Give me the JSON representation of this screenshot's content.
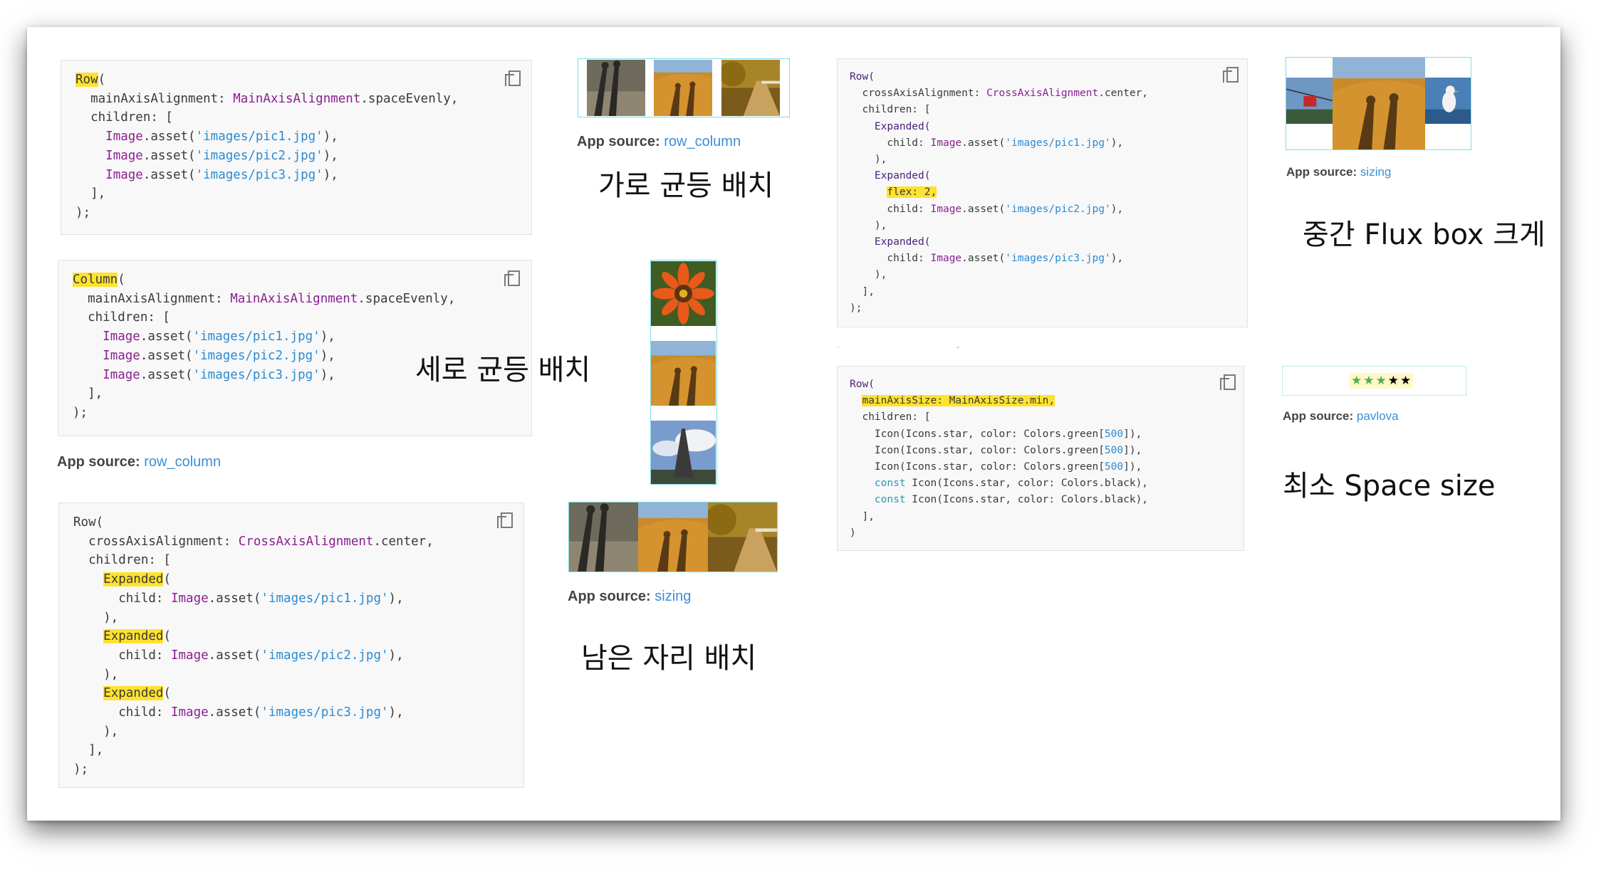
{
  "blocks": {
    "row_even": {
      "lines": [
        [
          {
            "t": "Row",
            "c": "hl"
          },
          {
            "t": "("
          }
        ],
        [
          {
            "t": "  mainAxisAlignment: "
          },
          {
            "t": "MainAxisAlignment",
            "c": "cls"
          },
          {
            "t": ".spaceEvenly,"
          }
        ],
        [
          {
            "t": "  children: ["
          }
        ],
        [
          {
            "t": "    "
          },
          {
            "t": "Image",
            "c": "cls"
          },
          {
            "t": ".asset("
          },
          {
            "t": "'images/pic1.jpg'",
            "c": "str"
          },
          {
            "t": "),"
          }
        ],
        [
          {
            "t": "    "
          },
          {
            "t": "Image",
            "c": "cls"
          },
          {
            "t": ".asset("
          },
          {
            "t": "'images/pic2.jpg'",
            "c": "str"
          },
          {
            "t": "),"
          }
        ],
        [
          {
            "t": "    "
          },
          {
            "t": "Image",
            "c": "cls"
          },
          {
            "t": ".asset("
          },
          {
            "t": "'images/pic3.jpg'",
            "c": "str"
          },
          {
            "t": "),"
          }
        ],
        [
          {
            "t": "  ],"
          }
        ],
        [
          {
            "t": ");"
          }
        ]
      ]
    },
    "column_even": {
      "lines": [
        [
          {
            "t": "Column",
            "c": "hl"
          },
          {
            "t": "("
          }
        ],
        [
          {
            "t": "  mainAxisAlignment: "
          },
          {
            "t": "MainAxisAlignment",
            "c": "cls"
          },
          {
            "t": ".spaceEvenly,"
          }
        ],
        [
          {
            "t": "  children: ["
          }
        ],
        [
          {
            "t": "    "
          },
          {
            "t": "Image",
            "c": "cls"
          },
          {
            "t": ".asset("
          },
          {
            "t": "'images/pic1.jpg'",
            "c": "str"
          },
          {
            "t": "),"
          }
        ],
        [
          {
            "t": "    "
          },
          {
            "t": "Image",
            "c": "cls"
          },
          {
            "t": ".asset("
          },
          {
            "t": "'images/pic2.jpg'",
            "c": "str"
          },
          {
            "t": "),"
          }
        ],
        [
          {
            "t": "    "
          },
          {
            "t": "Image",
            "c": "cls"
          },
          {
            "t": ".asset("
          },
          {
            "t": "'images/pic3.jpg'",
            "c": "str"
          },
          {
            "t": "),"
          }
        ],
        [
          {
            "t": "  ],"
          }
        ],
        [
          {
            "t": ");"
          }
        ]
      ]
    },
    "row_expanded": {
      "lines": [
        [
          {
            "t": "Row("
          }
        ],
        [
          {
            "t": "  crossAxisAlignment: "
          },
          {
            "t": "CrossAxisAlignment",
            "c": "cls"
          },
          {
            "t": ".center,"
          }
        ],
        [
          {
            "t": "  children: ["
          }
        ],
        [
          {
            "t": "    "
          },
          {
            "t": "Expanded",
            "c": "hl"
          },
          {
            "t": "("
          }
        ],
        [
          {
            "t": "      child: "
          },
          {
            "t": "Image",
            "c": "cls"
          },
          {
            "t": ".asset("
          },
          {
            "t": "'images/pic1.jpg'",
            "c": "str"
          },
          {
            "t": "),"
          }
        ],
        [
          {
            "t": "    ),"
          }
        ],
        [
          {
            "t": "    "
          },
          {
            "t": "Expanded",
            "c": "hl"
          },
          {
            "t": "("
          }
        ],
        [
          {
            "t": "      child: "
          },
          {
            "t": "Image",
            "c": "cls"
          },
          {
            "t": ".asset("
          },
          {
            "t": "'images/pic2.jpg'",
            "c": "str"
          },
          {
            "t": "),"
          }
        ],
        [
          {
            "t": "    ),"
          }
        ],
        [
          {
            "t": "    "
          },
          {
            "t": "Expanded",
            "c": "hl"
          },
          {
            "t": "("
          }
        ],
        [
          {
            "t": "      child: "
          },
          {
            "t": "Image",
            "c": "cls"
          },
          {
            "t": ".asset("
          },
          {
            "t": "'images/pic3.jpg'",
            "c": "str"
          },
          {
            "t": "),"
          }
        ],
        [
          {
            "t": "    ),"
          }
        ],
        [
          {
            "t": "  ],"
          }
        ],
        [
          {
            "t": ");"
          }
        ]
      ]
    },
    "row_flex": {
      "lines": [
        [
          {
            "t": "Row(",
            "c": "kw"
          }
        ],
        [
          {
            "t": "  crossAxisAlignment: "
          },
          {
            "t": "CrossAxisAlignment",
            "c": "cls"
          },
          {
            "t": ".center,"
          }
        ],
        [
          {
            "t": "  children: ["
          }
        ],
        [
          {
            "t": "    Expanded(",
            "c": "kw"
          }
        ],
        [
          {
            "t": "      child: "
          },
          {
            "t": "Image",
            "c": "cls"
          },
          {
            "t": ".asset("
          },
          {
            "t": "'images/pic1.jpg'",
            "c": "str"
          },
          {
            "t": "),"
          }
        ],
        [
          {
            "t": "    ),"
          }
        ],
        [
          {
            "t": "    Expanded(",
            "c": "kw"
          }
        ],
        [
          {
            "t": "      "
          },
          {
            "t": "flex: 2,",
            "c": "hl"
          }
        ],
        [
          {
            "t": "      child: "
          },
          {
            "t": "Image",
            "c": "cls"
          },
          {
            "t": ".asset("
          },
          {
            "t": "'images/pic2.jpg'",
            "c": "str"
          },
          {
            "t": "),"
          }
        ],
        [
          {
            "t": "    ),"
          }
        ],
        [
          {
            "t": "    Expanded(",
            "c": "kw"
          }
        ],
        [
          {
            "t": "      child: "
          },
          {
            "t": "Image",
            "c": "cls"
          },
          {
            "t": ".asset("
          },
          {
            "t": "'images/pic3.jpg'",
            "c": "str"
          },
          {
            "t": "),"
          }
        ],
        [
          {
            "t": "    ),"
          }
        ],
        [
          {
            "t": "  ],"
          }
        ],
        [
          {
            "t": ");"
          }
        ]
      ]
    },
    "row_min": {
      "lines": [
        [
          {
            "t": "Row(",
            "c": "kw"
          }
        ],
        [
          {
            "t": "  "
          },
          {
            "t": "mainAxisSize: MainAxisSize.min,",
            "c": "hl"
          }
        ],
        [
          {
            "t": "  children: ["
          }
        ],
        [
          {
            "t": "    Icon(Icons.star, color: Colors.green["
          },
          {
            "t": "500",
            "c": "num"
          },
          {
            "t": "]),"
          }
        ],
        [
          {
            "t": "    Icon(Icons.star, color: Colors.green["
          },
          {
            "t": "500",
            "c": "num"
          },
          {
            "t": "]),"
          }
        ],
        [
          {
            "t": "    Icon(Icons.star, color: Colors.green["
          },
          {
            "t": "500",
            "c": "num"
          },
          {
            "t": "]),"
          }
        ],
        [
          {
            "t": "    "
          },
          {
            "t": "const",
            "c": "const"
          },
          {
            "t": " Icon(Icons.star, color: Colors.black),"
          }
        ],
        [
          {
            "t": "    "
          },
          {
            "t": "const",
            "c": "const"
          },
          {
            "t": " Icon(Icons.star, color: Colors.black),"
          }
        ],
        [
          {
            "t": "  ],"
          }
        ],
        [
          {
            "t": ")"
          }
        ]
      ]
    }
  },
  "sources": {
    "label": "App source:",
    "row_column_1": "row_column",
    "row_column_2": "row_column",
    "sizing_1": "sizing",
    "sizing_2": "sizing",
    "pavlova": "pavlova"
  },
  "captions": {
    "row_even": "가로 균등 배치",
    "column_even": "세로 균등 배치",
    "expanded": "남은 자리 배치",
    "flex": "중간 Flux box 크게",
    "min": "최소 Space size"
  },
  "icons": {
    "copy": "copy-icon",
    "star": "star-icon"
  },
  "colors": {
    "highlight": "#ffe22e",
    "class": "#8b1f8f",
    "string": "#2a8bd0",
    "link": "#3b8ed6",
    "star_green": "#4caf50",
    "star_black": "#000000"
  },
  "stars": [
    "green",
    "green",
    "green",
    "black",
    "black"
  ]
}
